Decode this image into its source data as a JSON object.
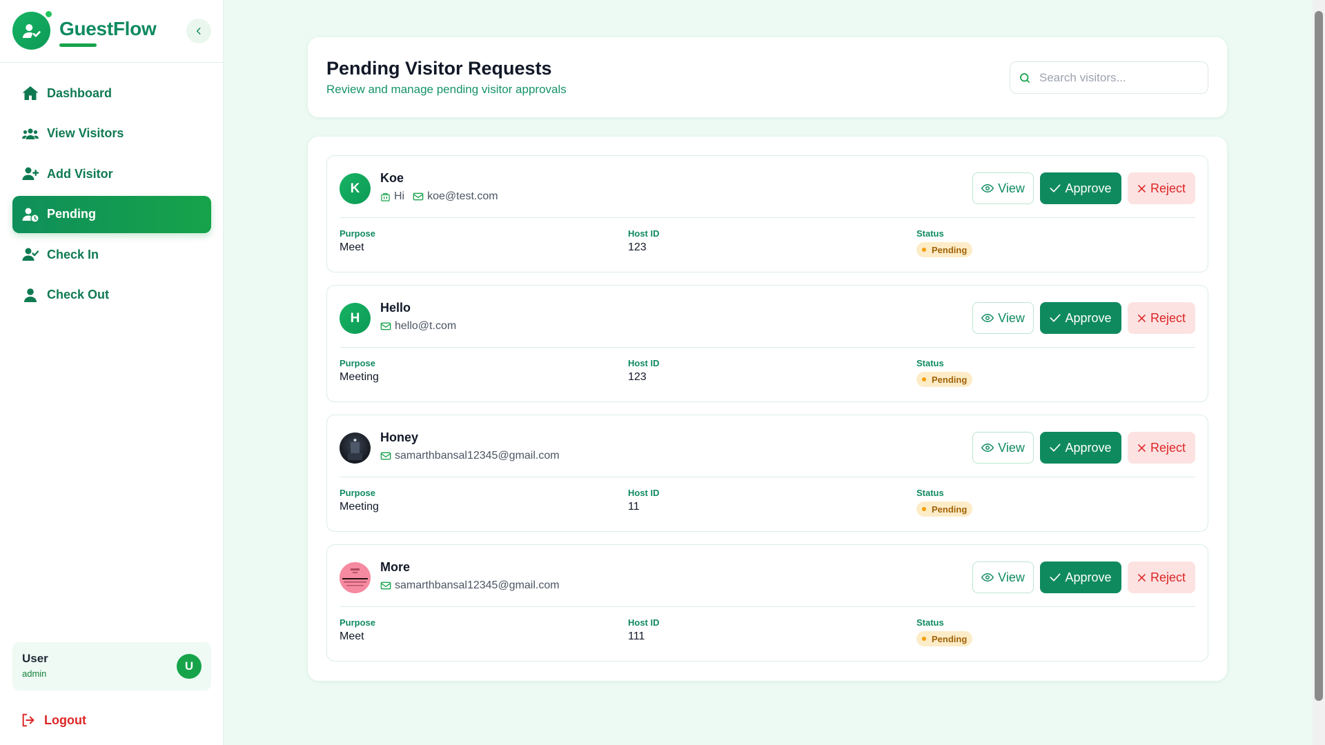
{
  "brand": {
    "name": "GuestFlow"
  },
  "sidebar": {
    "items": [
      {
        "label": "Dashboard",
        "icon": "home-icon"
      },
      {
        "label": "View Visitors",
        "icon": "users-icon"
      },
      {
        "label": "Add Visitor",
        "icon": "user-plus-icon"
      },
      {
        "label": "Pending",
        "icon": "user-clock-icon",
        "active": true
      },
      {
        "label": "Check In",
        "icon": "user-check-icon"
      },
      {
        "label": "Check Out",
        "icon": "user-icon"
      }
    ],
    "user": {
      "name": "User",
      "role": "admin",
      "initial": "U"
    },
    "logout": "Logout"
  },
  "header": {
    "title": "Pending Visitor Requests",
    "subtitle": "Review and manage pending visitor approvals",
    "search_placeholder": "Search visitors..."
  },
  "labels": {
    "view": "View",
    "approve": "Approve",
    "reject": "Reject",
    "purpose": "Purpose",
    "host_id": "Host ID",
    "status": "Status"
  },
  "visitors": [
    {
      "name": "Koe",
      "initial": "K",
      "company": "Hi",
      "email": "koe@test.com",
      "purpose": "Meet",
      "host_id": "123",
      "status": "Pending",
      "avatar": "letter"
    },
    {
      "name": "Hello",
      "initial": "H",
      "email": "hello@t.com",
      "purpose": "Meeting",
      "host_id": "123",
      "status": "Pending",
      "avatar": "letter"
    },
    {
      "name": "Honey",
      "email": "samarthbansal12345@gmail.com",
      "purpose": "Meeting",
      "host_id": "11",
      "status": "Pending",
      "avatar": "photo-dark"
    },
    {
      "name": "More",
      "email": "samarthbansal12345@gmail.com",
      "purpose": "Meet",
      "host_id": "111",
      "status": "Pending",
      "avatar": "photo-pink"
    }
  ],
  "colors": {
    "accent": "#0f8a5f",
    "accent_light": "#16a34a",
    "background": "#ecfaf3",
    "reject": "#dc2626",
    "pending_badge": "#fdecc8"
  }
}
